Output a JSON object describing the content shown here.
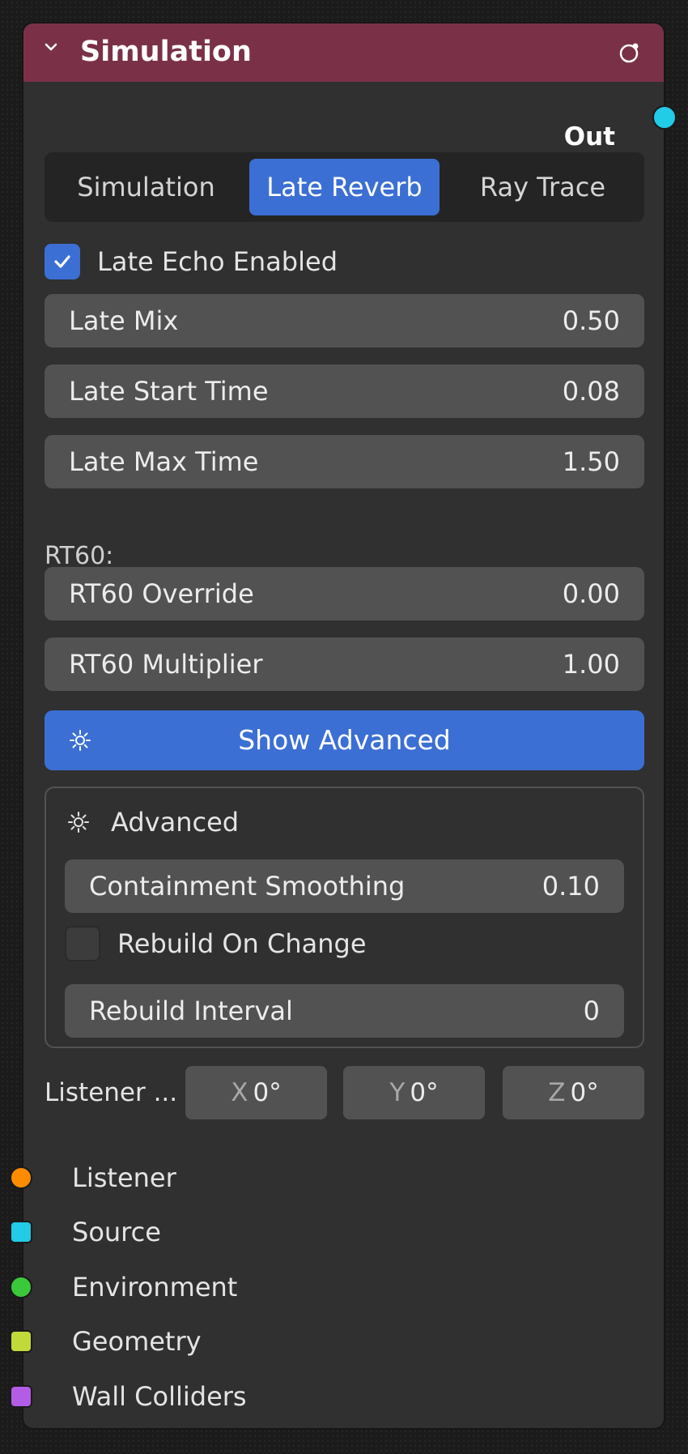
{
  "node": {
    "title": "Simulation",
    "header_color": "#7a3147",
    "output_label": "Out",
    "output_socket_color": "#22cbe6"
  },
  "tabs": [
    {
      "label": "Simulation",
      "active": false
    },
    {
      "label": "Late Reverb",
      "active": true
    },
    {
      "label": "Ray Trace",
      "active": false
    }
  ],
  "late_echo": {
    "label": "Late Echo Enabled",
    "checked": true
  },
  "fields": {
    "late_mix": {
      "label": "Late Mix",
      "value": "0.50"
    },
    "late_start_time": {
      "label": "Late Start Time",
      "value": "0.08"
    },
    "late_max_time": {
      "label": "Late Max Time",
      "value": "1.50"
    },
    "rt60_override": {
      "label": "RT60 Override",
      "value": "0.00"
    },
    "rt60_multiplier": {
      "label": "RT60 Multiplier",
      "value": "1.00"
    }
  },
  "rt60_section_label": "RT60:",
  "show_advanced_button": {
    "label": "Show Advanced",
    "icon": "gear-icon"
  },
  "advanced": {
    "title": "Advanced",
    "icon": "gear-icon",
    "containment_smoothing": {
      "label": "Containment Smoothing",
      "value": "0.10"
    },
    "rebuild_on_change": {
      "label": "Rebuild On Change",
      "checked": false
    },
    "rebuild_interval": {
      "label": "Rebuild Interval",
      "value": "0"
    }
  },
  "listener_rotation": {
    "label": "Listener ...",
    "x": {
      "axis": "X",
      "value": "0°"
    },
    "y": {
      "axis": "Y",
      "value": "0°"
    },
    "z": {
      "axis": "Z",
      "value": "0°"
    }
  },
  "inputs": [
    {
      "label": "Listener",
      "color": "#ff8c00",
      "shape": "round"
    },
    {
      "label": "Source",
      "color": "#22cbe6",
      "shape": "square"
    },
    {
      "label": "Environment",
      "color": "#3ac93a",
      "shape": "round"
    },
    {
      "label": "Geometry",
      "color": "#c2d93a",
      "shape": "square"
    },
    {
      "label": "Wall Colliders",
      "color": "#b35ce6",
      "shape": "square"
    }
  ],
  "colors": {
    "accent": "#3b6fd4",
    "node_bg": "#303030",
    "field_bg": "#525252"
  }
}
